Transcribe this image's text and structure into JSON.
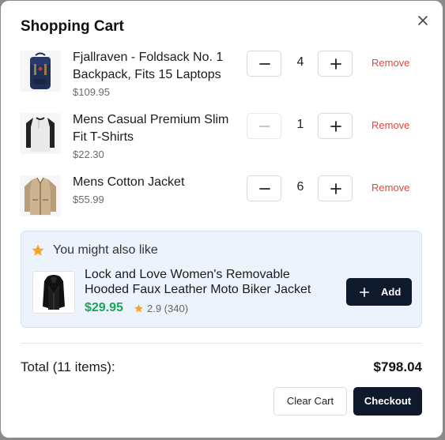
{
  "modal": {
    "title": "Shopping Cart"
  },
  "cart": {
    "items": [
      {
        "name": "Fjallraven - Foldsack No. 1 Backpack, Fits 15 Laptops",
        "price": "$109.95",
        "quantity": "4",
        "remove_label": "Remove",
        "decrement_disabled": false,
        "image": "backpack-image"
      },
      {
        "name": "Mens Casual Premium Slim Fit T-Shirts",
        "price": "$22.30",
        "quantity": "1",
        "remove_label": "Remove",
        "decrement_disabled": true,
        "image": "tshirt-image"
      },
      {
        "name": "Mens Cotton Jacket",
        "price": "$55.99",
        "quantity": "6",
        "remove_label": "Remove",
        "decrement_disabled": false,
        "image": "jacket-image"
      }
    ]
  },
  "suggestion": {
    "heading": "You might also like",
    "product_name": "Lock and Love Women's Removable Hooded Faux Leather Moto Biker Jacket",
    "price": "$29.95",
    "rating": "2.9 (340)",
    "add_label": "Add",
    "image": "leather-jacket-image"
  },
  "summary": {
    "total_label": "Total (11 items):",
    "total_value": "$798.04",
    "clear_label": "Clear Cart",
    "checkout_label": "Checkout"
  },
  "colors": {
    "remove": "#e0473f",
    "price_green": "#1aa65a",
    "primary_dark": "#0e1a2b",
    "star": "#f5a623",
    "suggestion_bg": "#edf3fd"
  }
}
